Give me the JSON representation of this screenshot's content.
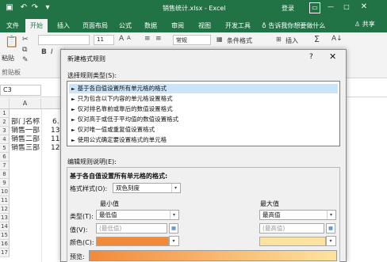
{
  "titlebar": {
    "doc_title": "销售统计.xlsx - Excel",
    "login": "登录",
    "qat": {
      "save_icon": "save-icon",
      "undo_icon": "undo-icon",
      "redo_icon": "redo-icon"
    }
  },
  "tabs": {
    "file": "文件",
    "home": "开始",
    "insert": "插入",
    "layout": "页面布局",
    "formulas": "公式",
    "data": "数据",
    "review": "审阅",
    "view": "视图",
    "developer": "开发工具",
    "tell_me": "告诉我你想要做什么",
    "share": "共享"
  },
  "ribbon": {
    "font_size": "11",
    "number_format": "常规",
    "paste_label": "粘贴",
    "clipboard_label": "剪贴板",
    "conditional_format": "条件格式",
    "insert_label": "插入"
  },
  "formula_bar": {
    "name_box": "C3"
  },
  "grid": {
    "columns": [
      "A"
    ],
    "rows": [
      "1",
      "2",
      "3",
      "4",
      "5",
      "6",
      "7",
      "8",
      "9",
      "10",
      "11",
      "12",
      "13",
      "14",
      "15",
      "16",
      "17"
    ],
    "cells": {
      "a2": "部门名称",
      "a3": "销售一部",
      "a4": "销售二部",
      "a5": "销售三部",
      "b2": "6.",
      "b3": "13.",
      "b4": "11.",
      "b5": "12."
    }
  },
  "dialog": {
    "title": "新建格式规则",
    "help": "?",
    "close": "✕",
    "rule_type_label": "选择规则类型(S):",
    "rule_types": [
      "基于各自值设置所有单元格的格式",
      "只为包含以下内容的单元格设置格式",
      "仅对排名靠前或靠后的数值设置格式",
      "仅对高于或低于平均值的数值设置格式",
      "仅对唯一值或重复值设置格式",
      "使用公式确定要设置格式的单元格"
    ],
    "desc_label": "编辑规则说明(E):",
    "desc_heading": "基于各自值设置所有单元格的格式:",
    "format_style_label": "格式样式(O):",
    "format_style_value": "双色刻度",
    "min_header": "最小值",
    "max_header": "最大值",
    "type_label": "类型(T):",
    "value_label": "值(V):",
    "color_label": "颜色(C):",
    "preview_label": "预览:",
    "min_type": "最低值",
    "max_type": "最高值",
    "min_value_placeholder": "(最低值)",
    "max_value_placeholder": "(最高值)",
    "min_color": "#f28a3a",
    "max_color": "#fde3a0"
  }
}
